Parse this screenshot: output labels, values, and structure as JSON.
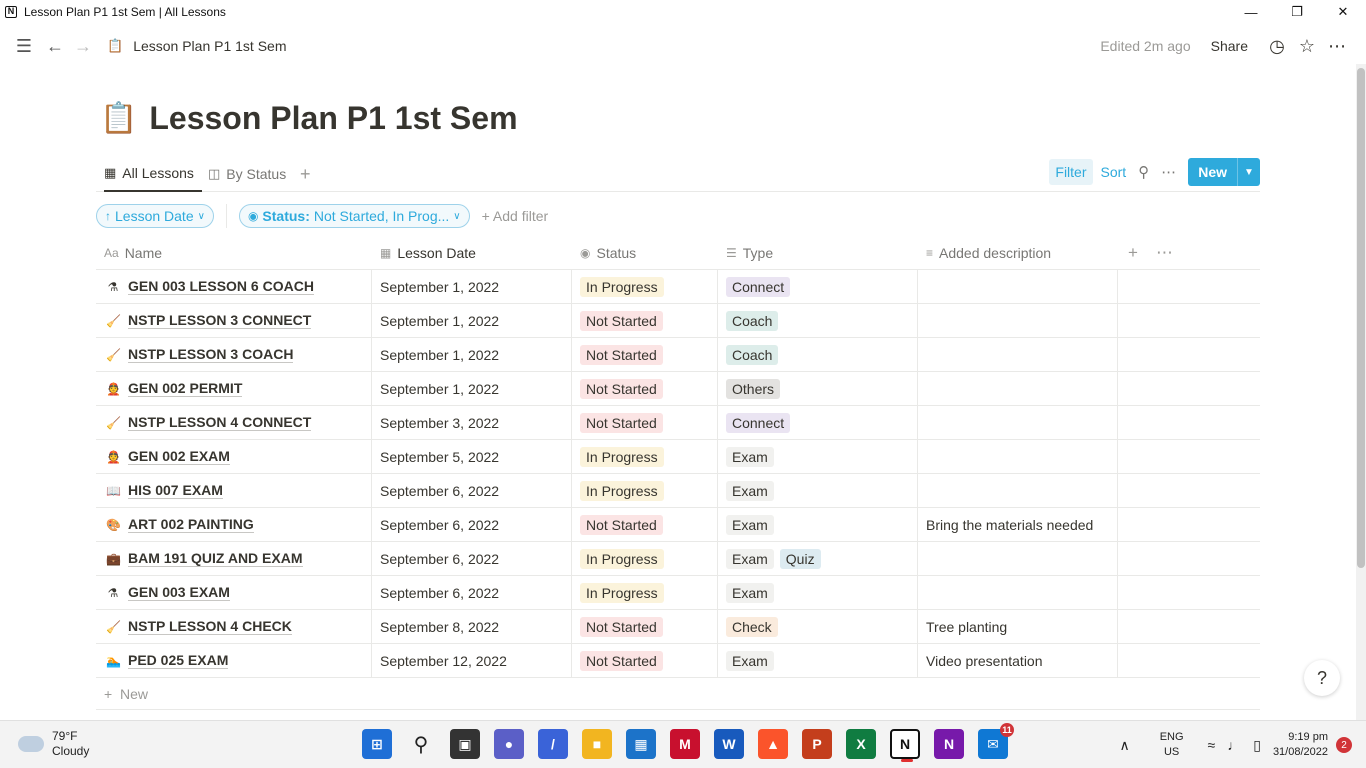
{
  "window": {
    "title": "Lesson Plan P1 1st Sem | All Lessons"
  },
  "topbar": {
    "breadcrumb": "Lesson Plan P1 1st Sem",
    "edited": "Edited 2m ago",
    "share": "Share"
  },
  "page": {
    "title": "Lesson Plan P1 1st Sem",
    "icon": "📋"
  },
  "views": {
    "tabs": [
      {
        "label": "All Lessons",
        "icon": "table-icon"
      },
      {
        "label": "By Status",
        "icon": "board-icon"
      }
    ],
    "filter": "Filter",
    "sort": "Sort",
    "new": "New"
  },
  "filters": {
    "sort_chip": "Lesson Date",
    "status_chip_key": "Status:",
    "status_chip_value": "Not Started, In Prog...",
    "add_filter": "Add filter"
  },
  "columns": {
    "name": "Name",
    "date": "Lesson Date",
    "status": "Status",
    "type": "Type",
    "desc": "Added description"
  },
  "colors": {
    "accent": "#2eaadc",
    "in_progress_bg": "#fbf3db",
    "not_started_bg": "#fbe4e4",
    "connect_bg": "#eae4f2",
    "coach_bg": "#ddedea",
    "others_bg": "#e3e2e0",
    "exam_bg": "#f1f1ef",
    "check_bg": "#faebdd",
    "quiz_bg": "#ddebf1"
  },
  "rows": [
    {
      "icon": "⚗",
      "name": "GEN 003 LESSON 6 COACH",
      "date": "September 1, 2022",
      "status": "In Progress",
      "types": [
        "Connect"
      ],
      "desc": ""
    },
    {
      "icon": "🧹",
      "name": "NSTP LESSON 3 CONNECT",
      "date": "September 1, 2022",
      "status": "Not Started",
      "types": [
        "Coach"
      ],
      "desc": ""
    },
    {
      "icon": "🧹",
      "name": "NSTP LESSON 3 COACH",
      "date": "September 1, 2022",
      "status": "Not Started",
      "types": [
        "Coach"
      ],
      "desc": ""
    },
    {
      "icon": "👲",
      "name": "GEN 002 PERMIT",
      "date": "September 1, 2022",
      "status": "Not Started",
      "types": [
        "Others"
      ],
      "desc": ""
    },
    {
      "icon": "🧹",
      "name": "NSTP LESSON 4 CONNECT",
      "date": "September 3, 2022",
      "status": "Not Started",
      "types": [
        "Connect"
      ],
      "desc": ""
    },
    {
      "icon": "👲",
      "name": "GEN 002 EXAM",
      "date": "September 5, 2022",
      "status": "In Progress",
      "types": [
        "Exam"
      ],
      "desc": ""
    },
    {
      "icon": "📖",
      "name": "HIS 007 EXAM",
      "date": "September 6, 2022",
      "status": "In Progress",
      "types": [
        "Exam"
      ],
      "desc": ""
    },
    {
      "icon": "🎨",
      "name": "ART 002 PAINTING",
      "date": "September 6, 2022",
      "status": "Not Started",
      "types": [
        "Exam"
      ],
      "desc": "Bring the materials needed"
    },
    {
      "icon": "💼",
      "name": "BAM 191 QUIZ AND EXAM",
      "date": "September 6, 2022",
      "status": "In Progress",
      "types": [
        "Exam",
        "Quiz"
      ],
      "desc": ""
    },
    {
      "icon": "⚗",
      "name": "GEN 003 EXAM",
      "date": "September 6, 2022",
      "status": "In Progress",
      "types": [
        "Exam"
      ],
      "desc": ""
    },
    {
      "icon": "🧹",
      "name": "NSTP LESSON 4 CHECK",
      "date": "September 8, 2022",
      "status": "Not Started",
      "types": [
        "Check"
      ],
      "desc": "Tree planting"
    },
    {
      "icon": "🏊",
      "name": "PED 025 EXAM",
      "date": "September 12, 2022",
      "status": "Not Started",
      "types": [
        "Exam"
      ],
      "desc": "Video presentation"
    }
  ],
  "new_row": "New",
  "help": "?",
  "taskbar": {
    "weather_temp": "79°F",
    "weather_desc": "Cloudy",
    "lang1": "ENG",
    "lang2": "US",
    "time": "9:19 pm",
    "date": "31/08/2022",
    "notif_count": "2",
    "mail_badge": "11"
  }
}
